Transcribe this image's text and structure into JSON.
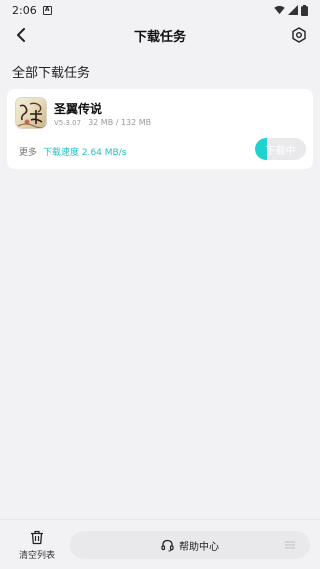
{
  "status_bar": {
    "time": "2:06",
    "notification_icon": "A"
  },
  "header": {
    "title": "下载任务"
  },
  "section": {
    "title": "全部下载任务"
  },
  "task": {
    "app_name": "圣翼传说",
    "version": "V5.3.07",
    "size_progress": "32 MB / 132 MB",
    "more_label": "更多",
    "speed_label": "下载速度 2.64 MB/s",
    "status_button_label": "下载中",
    "progress_percent": 24,
    "accent_color": "#1fd1cf"
  },
  "bottom_bar": {
    "clear_label": "清空列表",
    "help_label": "帮助中心"
  },
  "icons": {
    "back": "chevron-left",
    "settings": "hexagon-gear",
    "trash": "trash-can",
    "headset": "headset",
    "menu": "hamburger-lines"
  }
}
